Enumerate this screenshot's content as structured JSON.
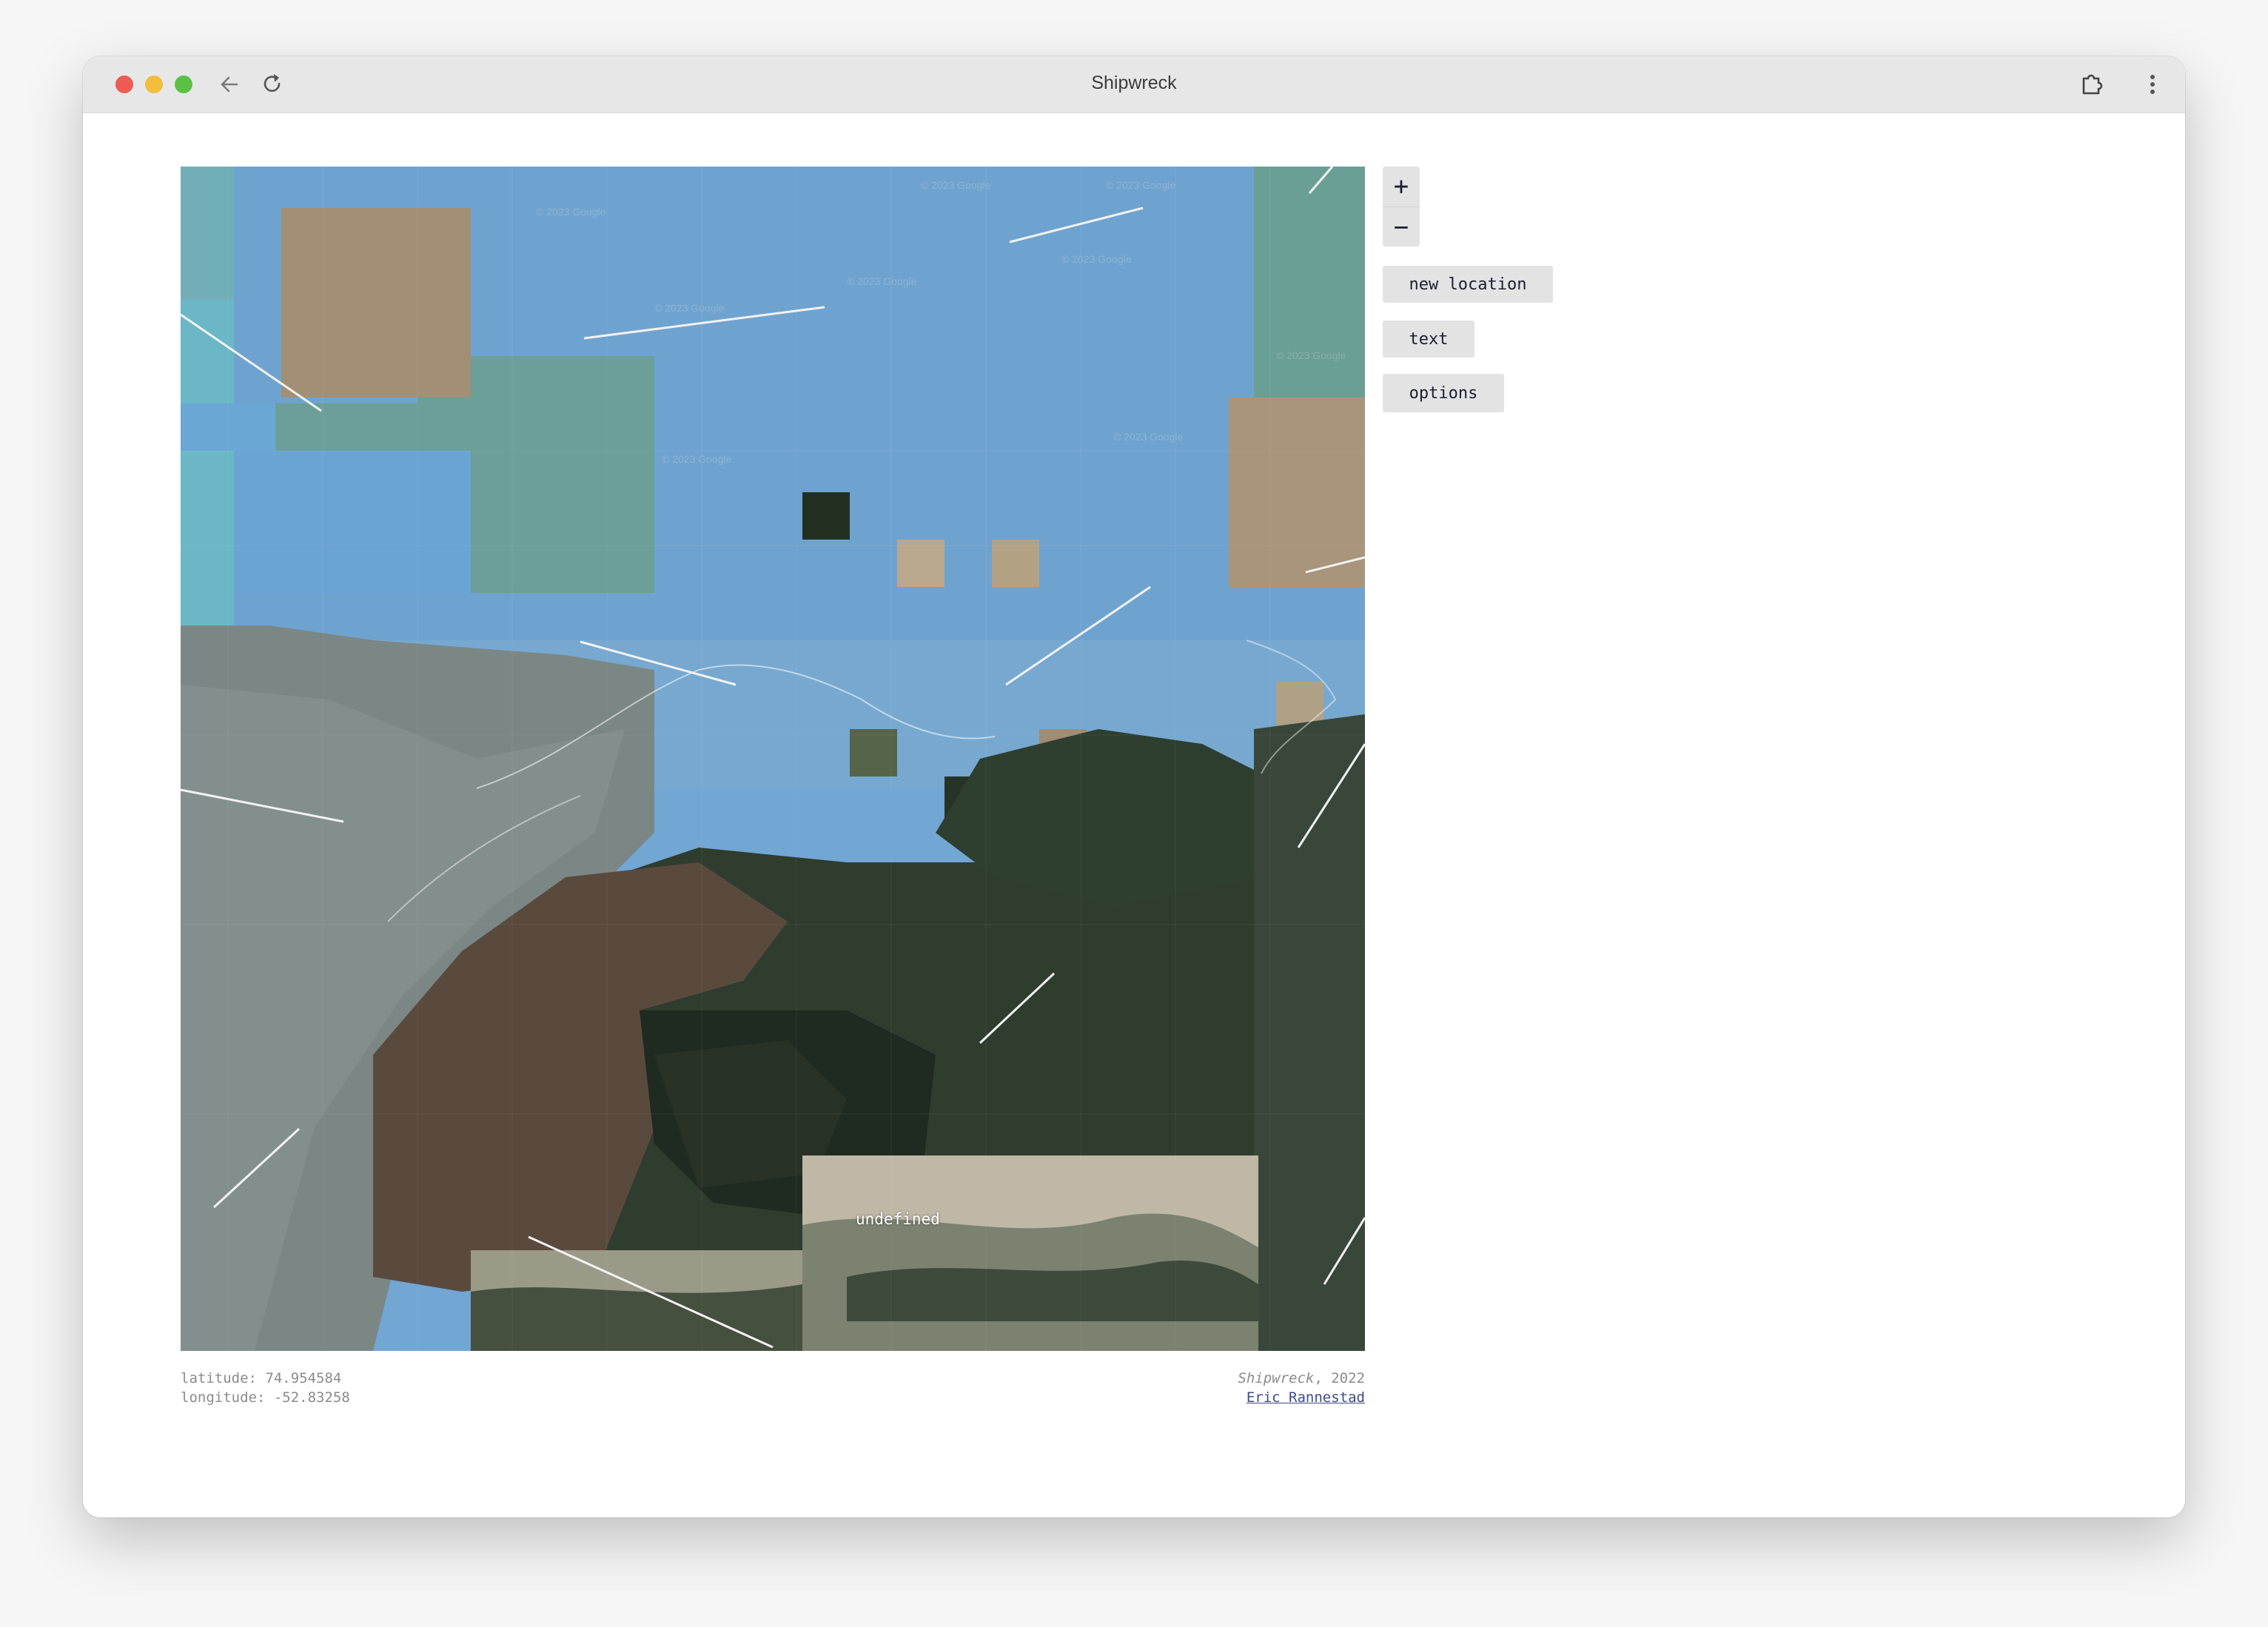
{
  "window": {
    "title": "Shipwreck"
  },
  "map": {
    "overlay_label": "undefined",
    "watermark": "© 2023 Google"
  },
  "controls": {
    "zoom_in": "+",
    "zoom_out": "−",
    "new_location": "new location",
    "text": "text",
    "options": "options"
  },
  "coordinates": {
    "latitude_line": "latitude: 74.954584",
    "longitude_line": "longitude: -52.83258"
  },
  "credit": {
    "work_title": "Shipwreck",
    "year": ", 2022",
    "author": "Eric Rannestad"
  },
  "colors": {
    "water": "#72a6d3",
    "shallow": "#6b9f97",
    "land_dark": "#2d3a2c",
    "land_brown": "#5a4a3e",
    "ice": "#7a8684",
    "sand": "#a18d73"
  }
}
